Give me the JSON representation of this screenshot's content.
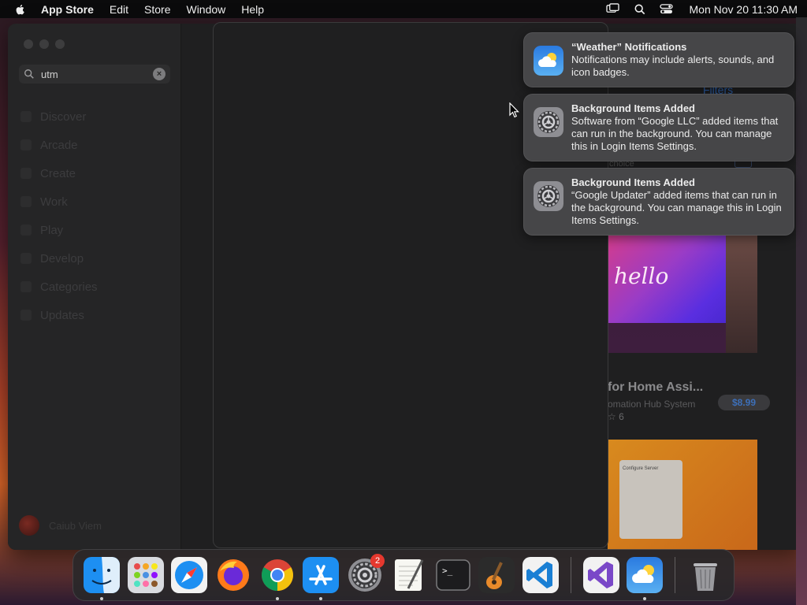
{
  "menubar": {
    "app_name": "App Store",
    "menus": [
      "Edit",
      "Store",
      "Window",
      "Help"
    ],
    "clock": "Mon Nov 20  11:30 AM"
  },
  "sidebar": {
    "search_value": "utm",
    "items": [
      {
        "label": "Discover"
      },
      {
        "label": "Arcade"
      },
      {
        "label": "Create"
      },
      {
        "label": "Work"
      },
      {
        "label": "Play"
      },
      {
        "label": "Develop"
      },
      {
        "label": "Categories"
      },
      {
        "label": "Updates"
      }
    ],
    "profile_name": "Caiub Viem"
  },
  "store": {
    "filters_label": "Filters",
    "choice_label": "choice",
    "hello_text": "hello",
    "app_title": "for Home Assi...",
    "app_subtitle": "omation Hub System",
    "rating": "☆  6",
    "price": "$8.99",
    "panel_title": "Configure Server"
  },
  "notifications": [
    {
      "title": "“Weather” Notifications",
      "body": "Notifications may include alerts, sounds, and icon badges.",
      "icon": "weather-icon"
    },
    {
      "title": "Background Items Added",
      "body": "Software from “Google LLC” added items that can run in the background. You can manage this in Login Items Settings.",
      "icon": "system-settings-icon"
    },
    {
      "title": "Background Items Added",
      "body": "“Google Updater” added items that can run in the background. You can manage this in Login Items Settings.",
      "icon": "system-settings-icon"
    }
  ],
  "dock": {
    "settings_badge": "2",
    "apps": [
      "finder",
      "launchpad",
      "safari",
      "firefox",
      "chrome",
      "app-store",
      "system-settings",
      "textedit",
      "terminal",
      "garageband",
      "vscode",
      "visual-studio",
      "weather",
      "trash"
    ]
  },
  "colors": {
    "accent": "#2d5fa8",
    "badge": "#e5382e",
    "notification_bg": "#48484a"
  }
}
